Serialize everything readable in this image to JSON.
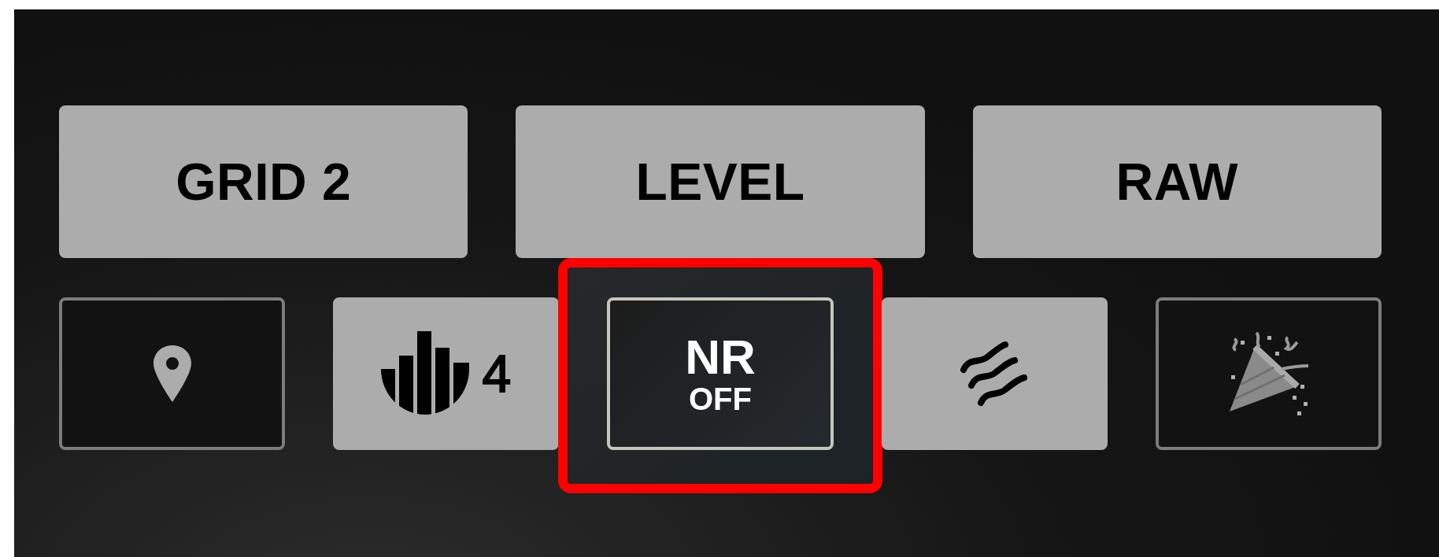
{
  "top_buttons": [
    {
      "label": "GRID 2",
      "on": true
    },
    {
      "label": "LEVEL",
      "on": true
    },
    {
      "label": "RAW",
      "on": true
    }
  ],
  "bottom_buttons": [
    {
      "kind": "pin",
      "on": false,
      "highlighted": false
    },
    {
      "kind": "bars",
      "label": "4",
      "on": true,
      "highlighted": false
    },
    {
      "kind": "text",
      "label": "NR",
      "sublabel": "OFF",
      "on": false,
      "highlighted": true
    },
    {
      "kind": "waves",
      "on": true,
      "highlighted": false
    },
    {
      "kind": "party",
      "on": false,
      "highlighted": false
    }
  ]
}
